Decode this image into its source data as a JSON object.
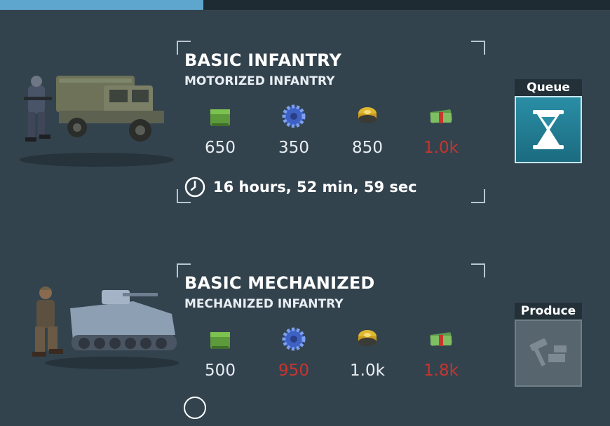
{
  "units": [
    {
      "title": "BASIC INFANTRY",
      "subtitle": "MOTORIZED INFANTRY",
      "resources": [
        {
          "icon": "supply-crate-icon",
          "value": "650",
          "short": false
        },
        {
          "icon": "component-gear-icon",
          "value": "350",
          "short": false
        },
        {
          "icon": "fuel-barrel-icon",
          "value": "850",
          "short": false
        },
        {
          "icon": "money-stack-icon",
          "value": "1.0k",
          "short": true
        }
      ],
      "time": "16 hours, 52 min, 59 sec",
      "action_label": "Queue",
      "action_icon": "hourglass-icon"
    },
    {
      "title": "BASIC MECHANIZED",
      "subtitle": "MECHANIZED INFANTRY",
      "resources": [
        {
          "icon": "supply-crate-icon",
          "value": "500",
          "short": false
        },
        {
          "icon": "component-gear-icon",
          "value": "950",
          "short": true
        },
        {
          "icon": "fuel-barrel-icon",
          "value": "1.0k",
          "short": false
        },
        {
          "icon": "money-stack-icon",
          "value": "1.8k",
          "short": true
        }
      ],
      "action_label": "Produce",
      "action_icon": "hammer-icon"
    }
  ],
  "colors": {
    "insufficient": "#c8342e",
    "queue": "#2a8ea5",
    "background": "#33434e"
  }
}
